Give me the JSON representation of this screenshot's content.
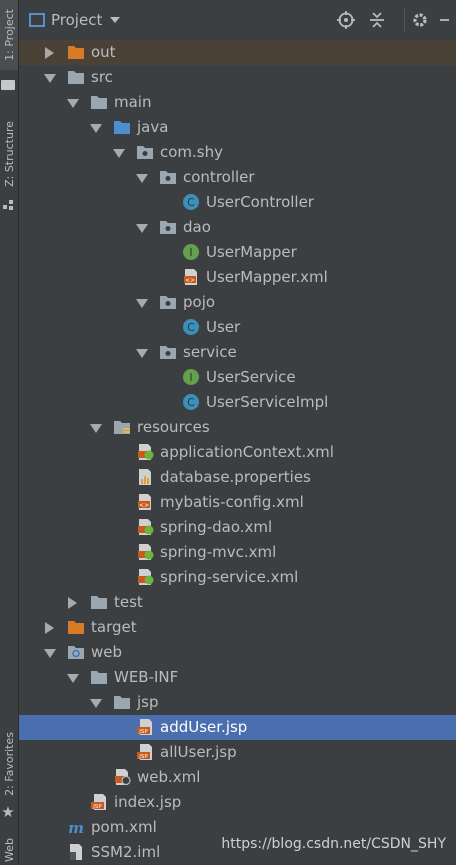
{
  "toolwindows": {
    "project": "1: Project",
    "structure": "Z: Structure",
    "favorites": "2: Favorites",
    "web": "Web"
  },
  "header": {
    "title": "Project"
  },
  "tree": [
    {
      "label": "out",
      "icon": "folder-orange-icon",
      "arrow": "right",
      "indent": 0
    },
    {
      "label": "src",
      "icon": "folder-icon",
      "arrow": "down",
      "indent": 0
    },
    {
      "label": "main",
      "icon": "folder-icon",
      "arrow": "down",
      "indent": 1
    },
    {
      "label": "java",
      "icon": "folder-blue-icon",
      "arrow": "down",
      "indent": 2
    },
    {
      "label": "com.shy",
      "icon": "package-icon",
      "arrow": "down",
      "indent": 3
    },
    {
      "label": "controller",
      "icon": "package-icon",
      "arrow": "down",
      "indent": 4
    },
    {
      "label": "UserController",
      "icon": "class-icon",
      "arrow": "none",
      "indent": 5
    },
    {
      "label": "dao",
      "icon": "package-icon",
      "arrow": "down",
      "indent": 4
    },
    {
      "label": "UserMapper",
      "icon": "interface-icon",
      "arrow": "none",
      "indent": 5
    },
    {
      "label": "UserMapper.xml",
      "icon": "xml-icon",
      "arrow": "none",
      "indent": 5
    },
    {
      "label": "pojo",
      "icon": "package-icon",
      "arrow": "down",
      "indent": 4
    },
    {
      "label": "User",
      "icon": "class-icon",
      "arrow": "none",
      "indent": 5
    },
    {
      "label": "service",
      "icon": "package-icon",
      "arrow": "down",
      "indent": 4
    },
    {
      "label": "UserService",
      "icon": "interface-icon",
      "arrow": "none",
      "indent": 5
    },
    {
      "label": "UserServiceImpl",
      "icon": "class-icon",
      "arrow": "none",
      "indent": 5
    },
    {
      "label": "resources",
      "icon": "resources-folder-icon",
      "arrow": "down",
      "indent": 2
    },
    {
      "label": "applicationContext.xml",
      "icon": "spring-xml-icon",
      "arrow": "none",
      "indent": 3
    },
    {
      "label": "database.properties",
      "icon": "properties-icon",
      "arrow": "none",
      "indent": 3
    },
    {
      "label": "mybatis-config.xml",
      "icon": "xml-icon",
      "arrow": "none",
      "indent": 3
    },
    {
      "label": "spring-dao.xml",
      "icon": "spring-xml-icon",
      "arrow": "none",
      "indent": 3
    },
    {
      "label": "spring-mvc.xml",
      "icon": "spring-xml-icon",
      "arrow": "none",
      "indent": 3
    },
    {
      "label": "spring-service.xml",
      "icon": "spring-xml-icon",
      "arrow": "none",
      "indent": 3
    },
    {
      "label": "test",
      "icon": "folder-icon",
      "arrow": "right",
      "indent": 1
    },
    {
      "label": "target",
      "icon": "folder-orange-icon",
      "arrow": "right",
      "indent": 0
    },
    {
      "label": "web",
      "icon": "web-folder-icon",
      "arrow": "down",
      "indent": 0
    },
    {
      "label": "WEB-INF",
      "icon": "folder-icon",
      "arrow": "down",
      "indent": 1
    },
    {
      "label": "jsp",
      "icon": "folder-icon",
      "arrow": "down",
      "indent": 2
    },
    {
      "label": "addUser.jsp",
      "icon": "jsp-icon",
      "arrow": "none",
      "indent": 3,
      "selected": true
    },
    {
      "label": "allUser.jsp",
      "icon": "jsp-icon",
      "arrow": "none",
      "indent": 3
    },
    {
      "label": "web.xml",
      "icon": "web-xml-icon",
      "arrow": "none",
      "indent": 2
    },
    {
      "label": "index.jsp",
      "icon": "jsp-icon",
      "arrow": "none",
      "indent": 1
    },
    {
      "label": "pom.xml",
      "icon": "maven-icon",
      "arrow": "none",
      "indent": 0
    },
    {
      "label": "SSM2.iml",
      "icon": "iml-icon",
      "arrow": "none",
      "indent": 0
    }
  ],
  "watermark": "https://blog.csdn.net/CSDN_SHY"
}
